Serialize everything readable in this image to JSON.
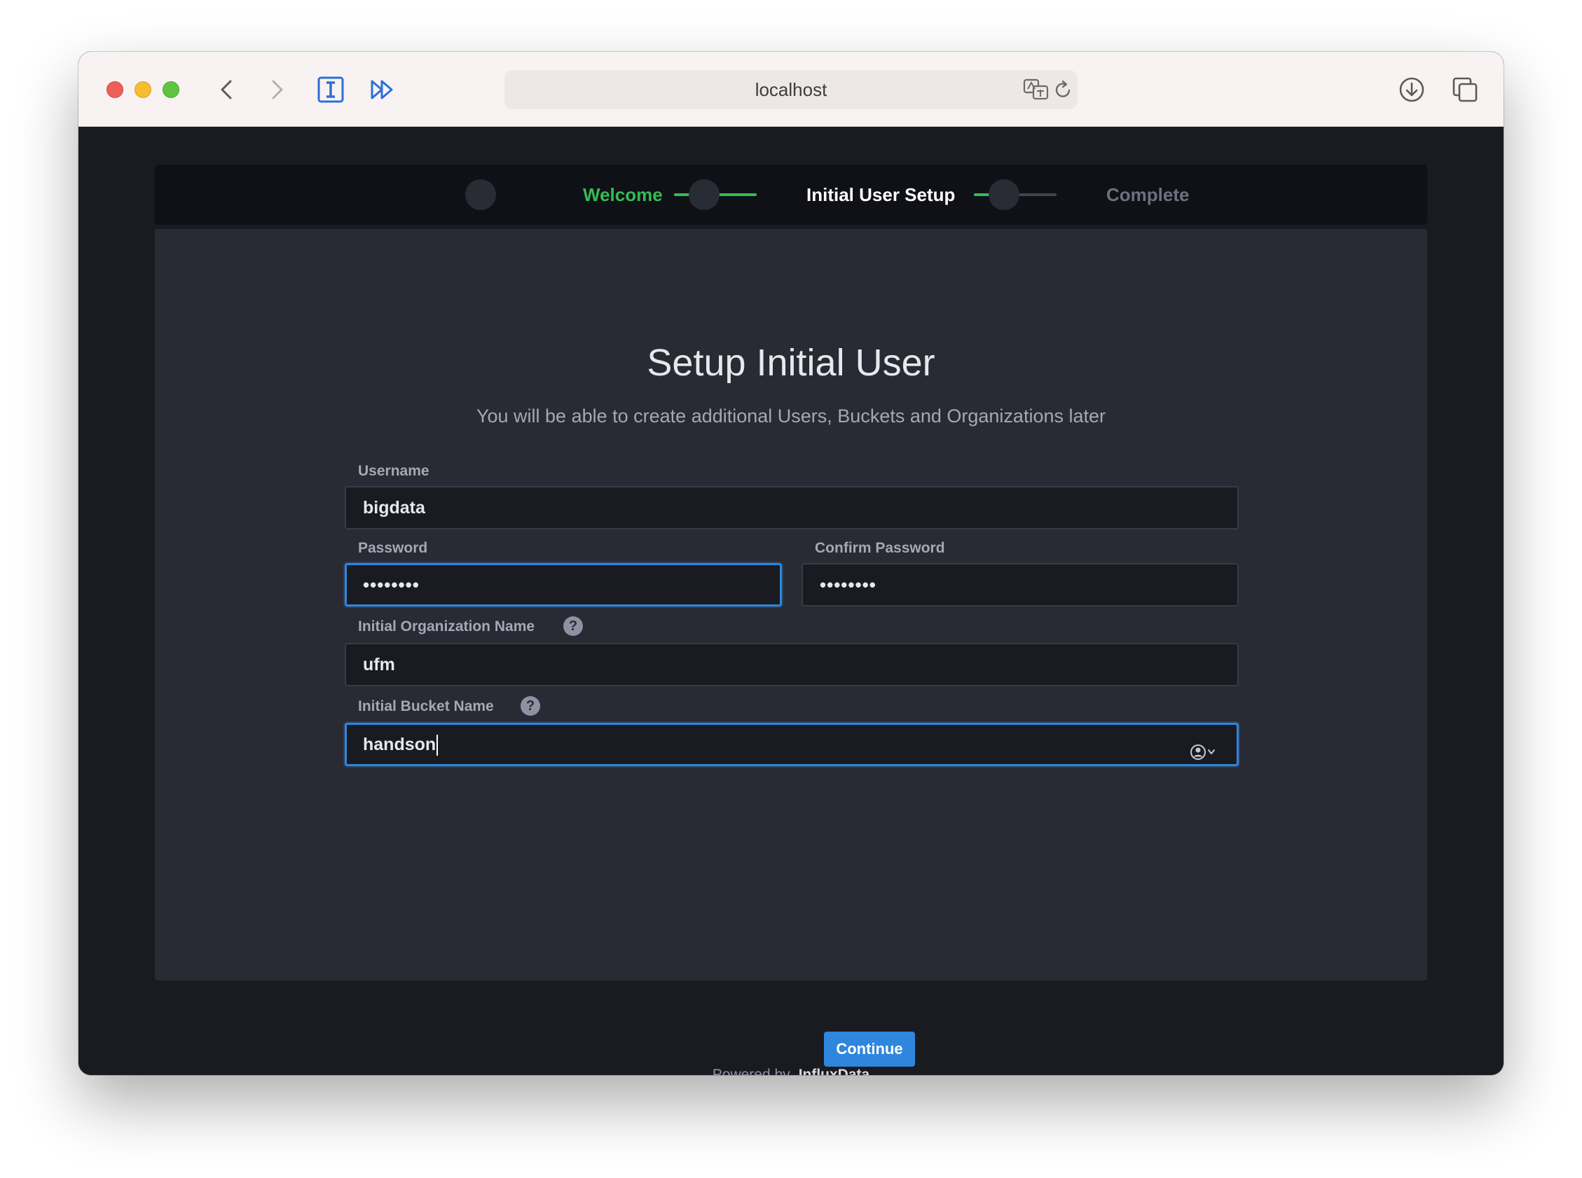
{
  "browser": {
    "url": "localhost",
    "icons": {
      "back": "chevron-left-icon",
      "forward": "chevron-right-icon",
      "reader": "text-cursor-icon",
      "extension": "fast-forward-icon",
      "translate": "translate-icon",
      "reload": "reload-icon",
      "downloads": "download-icon",
      "tabs": "tabs-icon"
    }
  },
  "stepper": {
    "steps": [
      {
        "label": "Welcome",
        "state": "done"
      },
      {
        "label": "Initial User Setup",
        "state": "current"
      },
      {
        "label": "Complete",
        "state": "pending"
      }
    ],
    "connector_progress": [
      1.0,
      0.5
    ]
  },
  "form": {
    "title": "Setup Initial User",
    "subtitle": "You will be able to create additional Users, Buckets and Organizations later",
    "username": {
      "label": "Username",
      "value": "bigdata"
    },
    "password": {
      "label": "Password",
      "value": "••••••••"
    },
    "confirm_password": {
      "label": "Confirm Password",
      "value": "••••••••"
    },
    "org": {
      "label": "Initial Organization Name",
      "value": "ufm",
      "help": "?"
    },
    "bucket": {
      "label": "Initial Bucket Name",
      "value": "handson",
      "help": "?"
    },
    "continue_label": "Continue"
  },
  "footer": {
    "prefix": "Powered by",
    "brand": "InfluxData"
  },
  "colors": {
    "accent": "#2f86dd",
    "step_done": "#34bb55",
    "background": "#1a1b21",
    "panel": "#292a33"
  }
}
